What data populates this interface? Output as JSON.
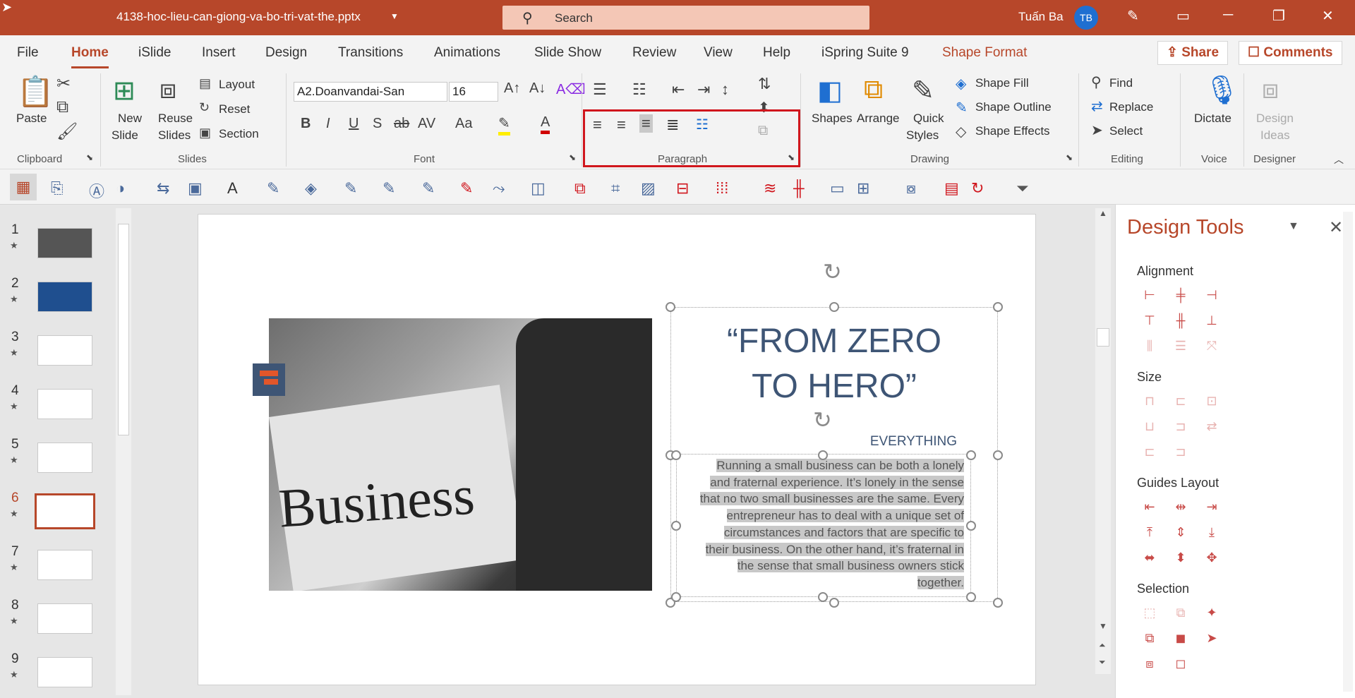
{
  "title_bar": {
    "filename": "4138-hoc-lieu-can-giong-va-bo-tri-vat-the.pptx",
    "search_placeholder": "Search",
    "user_name": "Tuấn Ba",
    "user_initials": "TB"
  },
  "menu": {
    "tabs": [
      "File",
      "Home",
      "iSlide",
      "Insert",
      "Design",
      "Transitions",
      "Animations",
      "Slide Show",
      "Review",
      "View",
      "Help",
      "iSpring Suite 9",
      "Shape Format"
    ],
    "active_tab": "Home",
    "share": "Share",
    "comments": "Comments"
  },
  "ribbon": {
    "clipboard": {
      "label": "Clipboard",
      "paste": "Paste"
    },
    "slides": {
      "label": "Slides",
      "new_slide_1": "New",
      "new_slide_2": "Slide",
      "reuse_1": "Reuse",
      "reuse_2": "Slides",
      "layout": "Layout",
      "reset": "Reset",
      "section": "Section"
    },
    "font": {
      "label": "Font",
      "font_name": "A2.Doanvandai-San",
      "font_size": "16"
    },
    "paragraph": {
      "label": "Paragraph"
    },
    "drawing": {
      "label": "Drawing",
      "shapes": "Shapes",
      "arrange": "Arrange",
      "quick_1": "Quick",
      "quick_2": "Styles",
      "shape_fill": "Shape Fill",
      "shape_outline": "Shape Outline",
      "shape_effects": "Shape Effects"
    },
    "editing": {
      "label": "Editing",
      "find": "Find",
      "replace": "Replace",
      "select": "Select"
    },
    "voice": {
      "label": "Voice",
      "dictate": "Dictate"
    },
    "designer": {
      "label": "Designer",
      "ideas_1": "Design",
      "ideas_2": "Ideas"
    }
  },
  "thumbnails": [
    "1",
    "2",
    "3",
    "4",
    "5",
    "6",
    "7",
    "8",
    "9"
  ],
  "active_slide": "6",
  "slide": {
    "title_line1": "“FROM ZERO",
    "title_line2": "TO HERO”",
    "subtitle": "EVERYTHING",
    "body_lines": [
      "Running a small business can be both a lonely",
      "and fraternal experience. It’s lonely in the sense",
      "that no two small businesses are the same. Every",
      "entrepreneur has to deal with a unique set of",
      "circumstances and factors that are specific to",
      "their business. On the other hand, it’s fraternal in",
      "the sense that small business owners stick",
      "together."
    ],
    "photo_word": "Business"
  },
  "design_tools": {
    "title": "Design Tools",
    "sections": [
      "Alignment",
      "Size",
      "Guides Layout",
      "Selection"
    ]
  },
  "colors": {
    "accent": "#b7472a",
    "slide_text": "#3e5575",
    "highlight_box": "#d0161d"
  }
}
